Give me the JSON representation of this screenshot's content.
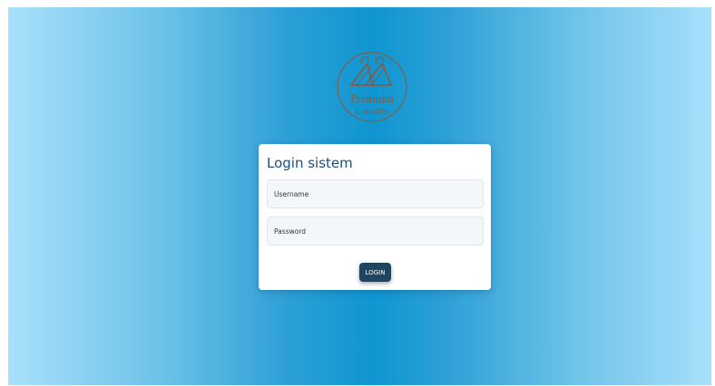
{
  "login": {
    "title": "Login sistem",
    "username_placeholder": "Username",
    "password_placeholder": "Password",
    "button_label": "LOGIN"
  },
  "logo": {
    "name": "hanger-logo-icon",
    "text_line1": "Premium",
    "text_line2": "Laundry"
  },
  "colors": {
    "background_center": "#0f96d1",
    "background_edge": "#a9e0fb",
    "title": "#1a4f7a",
    "button": "#1f4560",
    "logo": "#8a5a3c"
  }
}
